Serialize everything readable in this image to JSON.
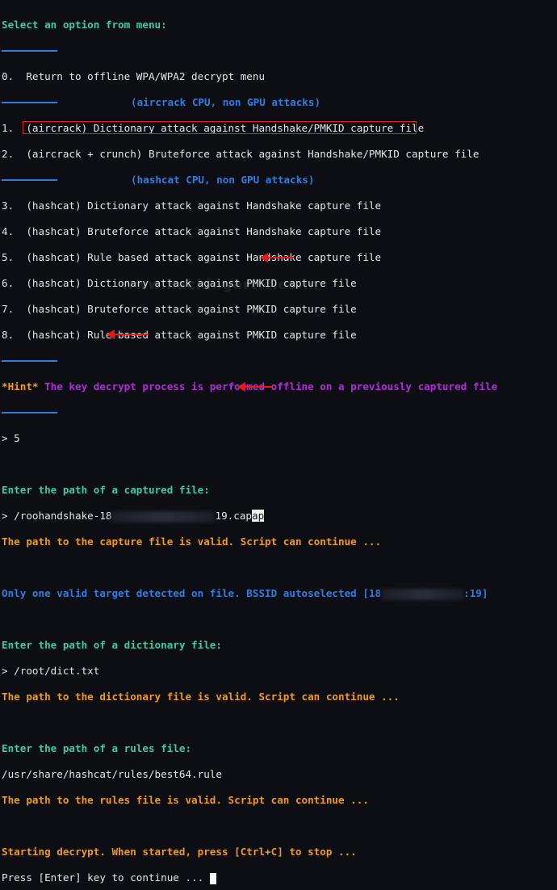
{
  "terminal": {
    "menu_prompt": "Select an option from menu:",
    "option_0": "0.  Return to offline WPA/WPA2 decrypt menu",
    "aircrack_header": "(aircrack CPU, non GPU attacks)",
    "option_1": "1.  (aircrack) Dictionary attack against Handshake/PMKID capture file",
    "option_2": "2.  (aircrack + crunch) Bruteforce attack against Handshake/PMKID capture file",
    "hashcat_header": "(hashcat CPU, non GPU attacks)",
    "option_3": "3.  (hashcat) Dictionary attack against Handshake capture file",
    "option_4": "4.  (hashcat) Bruteforce attack against Handshake capture file",
    "option_5": "5.  (hashcat) Rule based attack against Handshake capture file",
    "option_6": "6.  (hashcat) Dictionary attack against PMKID capture file",
    "option_7": "7.  (hashcat) Bruteforce attack against PMKID capture file",
    "option_8": "8.  (hashcat) Rule based attack against PMKID capture file",
    "hint_label": "*Hint*",
    "hint_text": " The key decrypt process is performed offline on a previously captured file",
    "input_selection": "> 5",
    "capture_prompt": "Enter the path of a captured file:",
    "capture_input_prefix": "> /roohandshake-18",
    "capture_input_suffix": "19.cap",
    "capture_input_cursor": "ap",
    "capture_valid": "The path to the capture file is valid. Script can continue ...",
    "target_detected_prefix": "Only one valid target detected on file. BSSID autoselected [",
    "bssid_prefix": "18",
    "bssid_suffix": ":19",
    "target_detected_suffix": "]",
    "dict_prompt": "Enter the path of a dictionary file:",
    "dict_input": "> /root/dict.txt",
    "dict_valid": "The path to the dictionary file is valid. Script can continue ...",
    "rules_prompt": "Enter the path of a rules file:",
    "rules_input": "/usr/share/hashcat/rules/best64.rule",
    "rules_valid": "The path to the rules file is valid. Script can continue ...",
    "start_message": "Starting decrypt. When started, press [Ctrl+C] to stop ...",
    "continue_prompt": "Press [Enter] key to continue ..."
  },
  "watermark": "www.hackingarticles.in",
  "colors": {
    "background": "#0c0e13",
    "green": "#3ec9a7",
    "blue": "#2f7de0",
    "orange": "#f09b1c",
    "magenta": "#b22bd9",
    "text": "#e6e6e6",
    "annotation_red": "#e81818"
  },
  "annotations": {
    "highlighted_option": "5",
    "arrow_targets": [
      "capture-file-input",
      "dictionary-input",
      "rules-input"
    ]
  }
}
